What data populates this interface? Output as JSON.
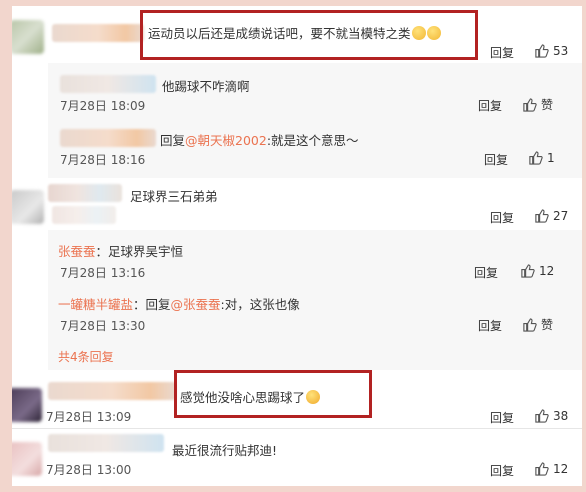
{
  "reply_label": "回复",
  "like_label": "赞",
  "more_replies": "共4条回复",
  "comments": [
    {
      "text": "运动员以后还是成绩说话吧，要不就当模特之类",
      "likes": "53",
      "reply": "回复"
    },
    {
      "text": "足球界三石弟弟",
      "likes": "27",
      "reply": "回复"
    },
    {
      "time": "7月28日 13:09",
      "text": "感觉他没啥心思踢球了",
      "likes": "38",
      "reply": "回复"
    },
    {
      "time": "7月28日 13:00",
      "text": "最近很流行贴邦迪!",
      "likes": "12",
      "reply": "回复"
    }
  ],
  "subreplies": [
    {
      "text": "他踢球不咋滴啊",
      "time": "7月28日 18:09",
      "likes": "赞"
    },
    {
      "prefix": "回复",
      "mention": "@朝天椒2002",
      "text": ":就是这个意思～",
      "time": "7月28日 18:16",
      "likes": "1"
    },
    {
      "name": "张蚕蚕",
      "text": "：足球界吴宇恒",
      "time": "7月28日 13:16",
      "likes": "12"
    },
    {
      "name": "一罐糖半罐盐",
      "prefix": "：回复",
      "mention": "@张蚕蚕",
      "text": ":对，这张也像",
      "time": "7月28日 13:30",
      "likes": "赞"
    }
  ],
  "colors": {
    "highlight": "#b22222",
    "accent": "#eb7350",
    "background": "#f2d6cd"
  }
}
